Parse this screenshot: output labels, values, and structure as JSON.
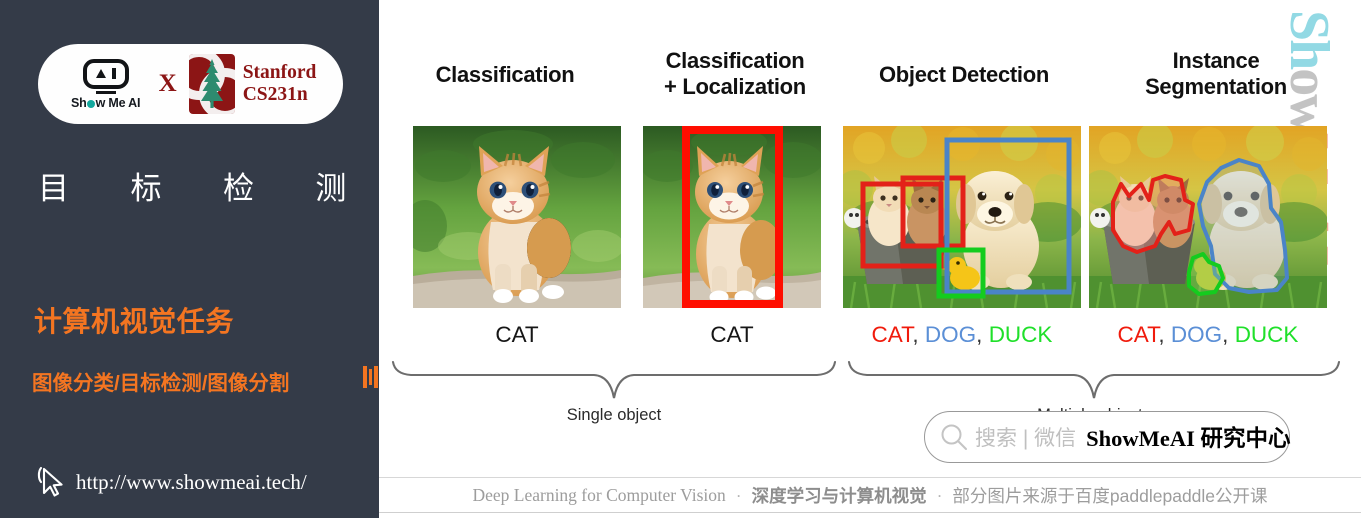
{
  "sidebar": {
    "logo": {
      "showmeai_text": "Show Me AI",
      "cross": "X",
      "stanford_line1": "Stanford",
      "stanford_line2": "CS231n",
      "robot_icon": "smai-robot-icon",
      "tree_icon": "stanford-tree-icon"
    },
    "title_chars": [
      "目",
      "标",
      "检",
      "测"
    ],
    "subtitle": "计算机视觉任务",
    "topics": "图像分类/目标检测/图像分割",
    "url": "http://www.showmeai.tech/",
    "cursor_icon": "cursor-arrow-icon",
    "bg_color": "#343b48",
    "accent_color": "#f47521"
  },
  "main": {
    "watermark": "ShowMeAI",
    "columns": [
      {
        "heading": "Classification",
        "caption_parts": [
          {
            "text": "CAT",
            "color": "#161616"
          }
        ],
        "photo": "kitten-on-stone-photo",
        "boxes": []
      },
      {
        "heading": "Classification\n+ Localization",
        "heading_line1": "Classification",
        "heading_line2": "+ Localization",
        "caption_parts": [
          {
            "text": "CAT",
            "color": "#161616"
          }
        ],
        "photo": "kitten-on-stone-photo",
        "boxes": [
          {
            "name": "cat-bbox",
            "color": "#ff0000"
          }
        ]
      },
      {
        "heading": "Object Detection",
        "caption_parts": [
          {
            "text": "CAT",
            "color": "#f01b0c"
          },
          {
            "text": ", ",
            "color": "#333333"
          },
          {
            "text": "DOG",
            "color": "#5b8fd6"
          },
          {
            "text": ", ",
            "color": "#333333"
          },
          {
            "text": "DUCK",
            "color": "#1fe02a"
          }
        ],
        "photo": "puppy-kittens-duck-photo",
        "boxes": [
          {
            "name": "cat-bbox-1",
            "color": "#e02020"
          },
          {
            "name": "cat-bbox-2",
            "color": "#e02020"
          },
          {
            "name": "dog-bbox",
            "color": "#4a84c8"
          },
          {
            "name": "duck-bbox",
            "color": "#11cc22"
          }
        ]
      },
      {
        "heading": "Instance\nSegmentation",
        "heading_line1": "Instance",
        "heading_line2": "Segmentation",
        "caption_parts": [
          {
            "text": "CAT",
            "color": "#f01b0c"
          },
          {
            "text": ", ",
            "color": "#333333"
          },
          {
            "text": "DOG",
            "color": "#5b8fd6"
          },
          {
            "text": ", ",
            "color": "#333333"
          },
          {
            "text": "DUCK",
            "color": "#1fe02a"
          }
        ],
        "photo": "puppy-kittens-duck-photo",
        "boxes": [
          {
            "name": "cat-mask",
            "color": "#e02020"
          },
          {
            "name": "dog-mask",
            "color": "#4a84c8"
          },
          {
            "name": "duck-mask",
            "color": "#11cc22"
          }
        ]
      }
    ],
    "group_left_label": "Single object",
    "group_right_label": "Multiple objects"
  },
  "search_overlay": {
    "icon": "search-icon",
    "placeholder": "搜索 | 微信",
    "brand": "ShowMeAI 研究中心"
  },
  "footer": {
    "english": "Deep Learning for Computer Vision",
    "dot1": "·",
    "chinese": "深度学习与计算机视觉",
    "dot2": "·",
    "source": "部分图片来源于百度paddlepaddle公开课"
  }
}
